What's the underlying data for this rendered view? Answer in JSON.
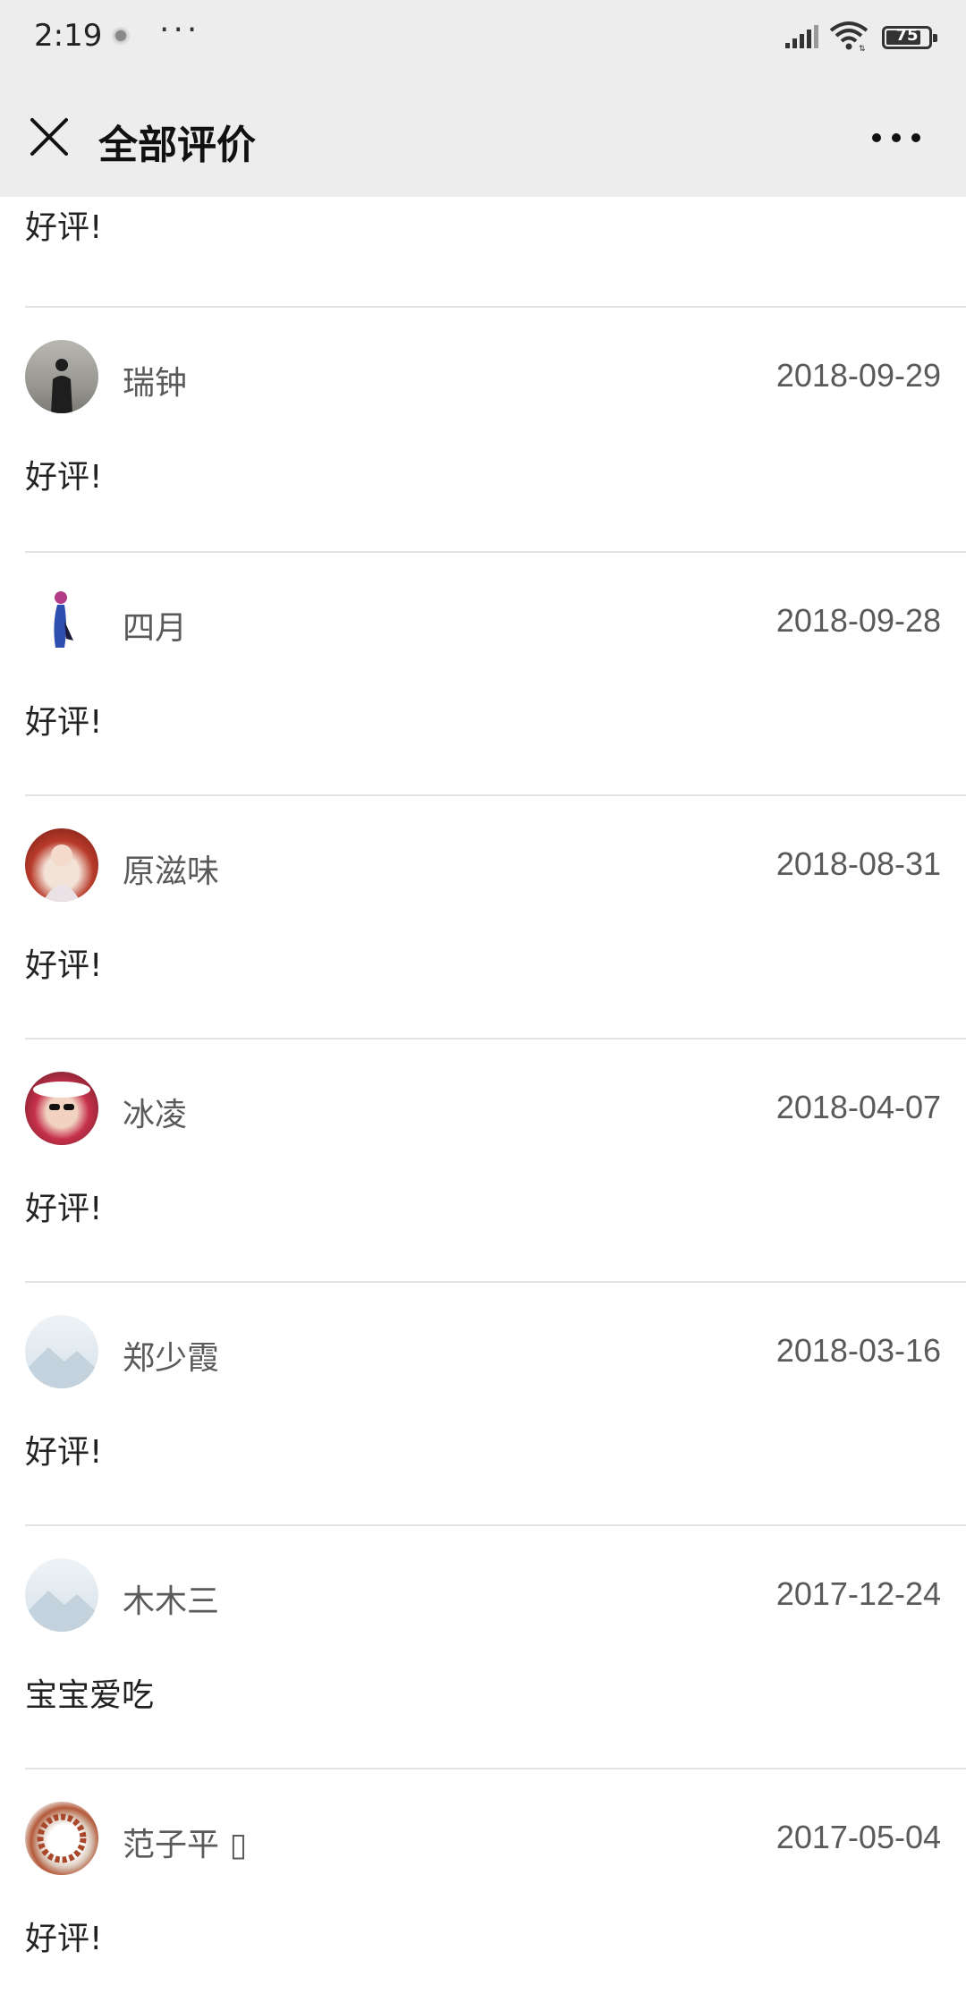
{
  "status_bar": {
    "time": "2:19",
    "dots": "···",
    "battery": "75",
    "icons": [
      "app-notification-icon",
      "signal-icon",
      "wifi-icon",
      "battery-icon"
    ]
  },
  "nav": {
    "title": "全部评价",
    "close_icon": "close-icon",
    "more_icon": "more-icon"
  },
  "partial_review": {
    "text": "好评!"
  },
  "reviews": [
    {
      "name": "瑞钟",
      "date": "2018-09-29",
      "text": "好评!"
    },
    {
      "name": "四月",
      "date": "2018-09-28",
      "text": "好评!"
    },
    {
      "name": "原滋味",
      "date": "2018-08-31",
      "text": "好评!"
    },
    {
      "name": "冰凌",
      "date": "2018-04-07",
      "text": "好评!"
    },
    {
      "name": "郑少霞",
      "date": "2018-03-16",
      "text": "好评!"
    },
    {
      "name": "木木三",
      "date": "2017-12-24",
      "text": "宝宝爱吃"
    },
    {
      "name": "范子平 ▯",
      "date": "2017-05-04",
      "text": "好评!"
    }
  ],
  "colors": {
    "header_bg": "#ededed",
    "divider": "#e3e3e3",
    "meta_text": "#5a5a5a"
  }
}
